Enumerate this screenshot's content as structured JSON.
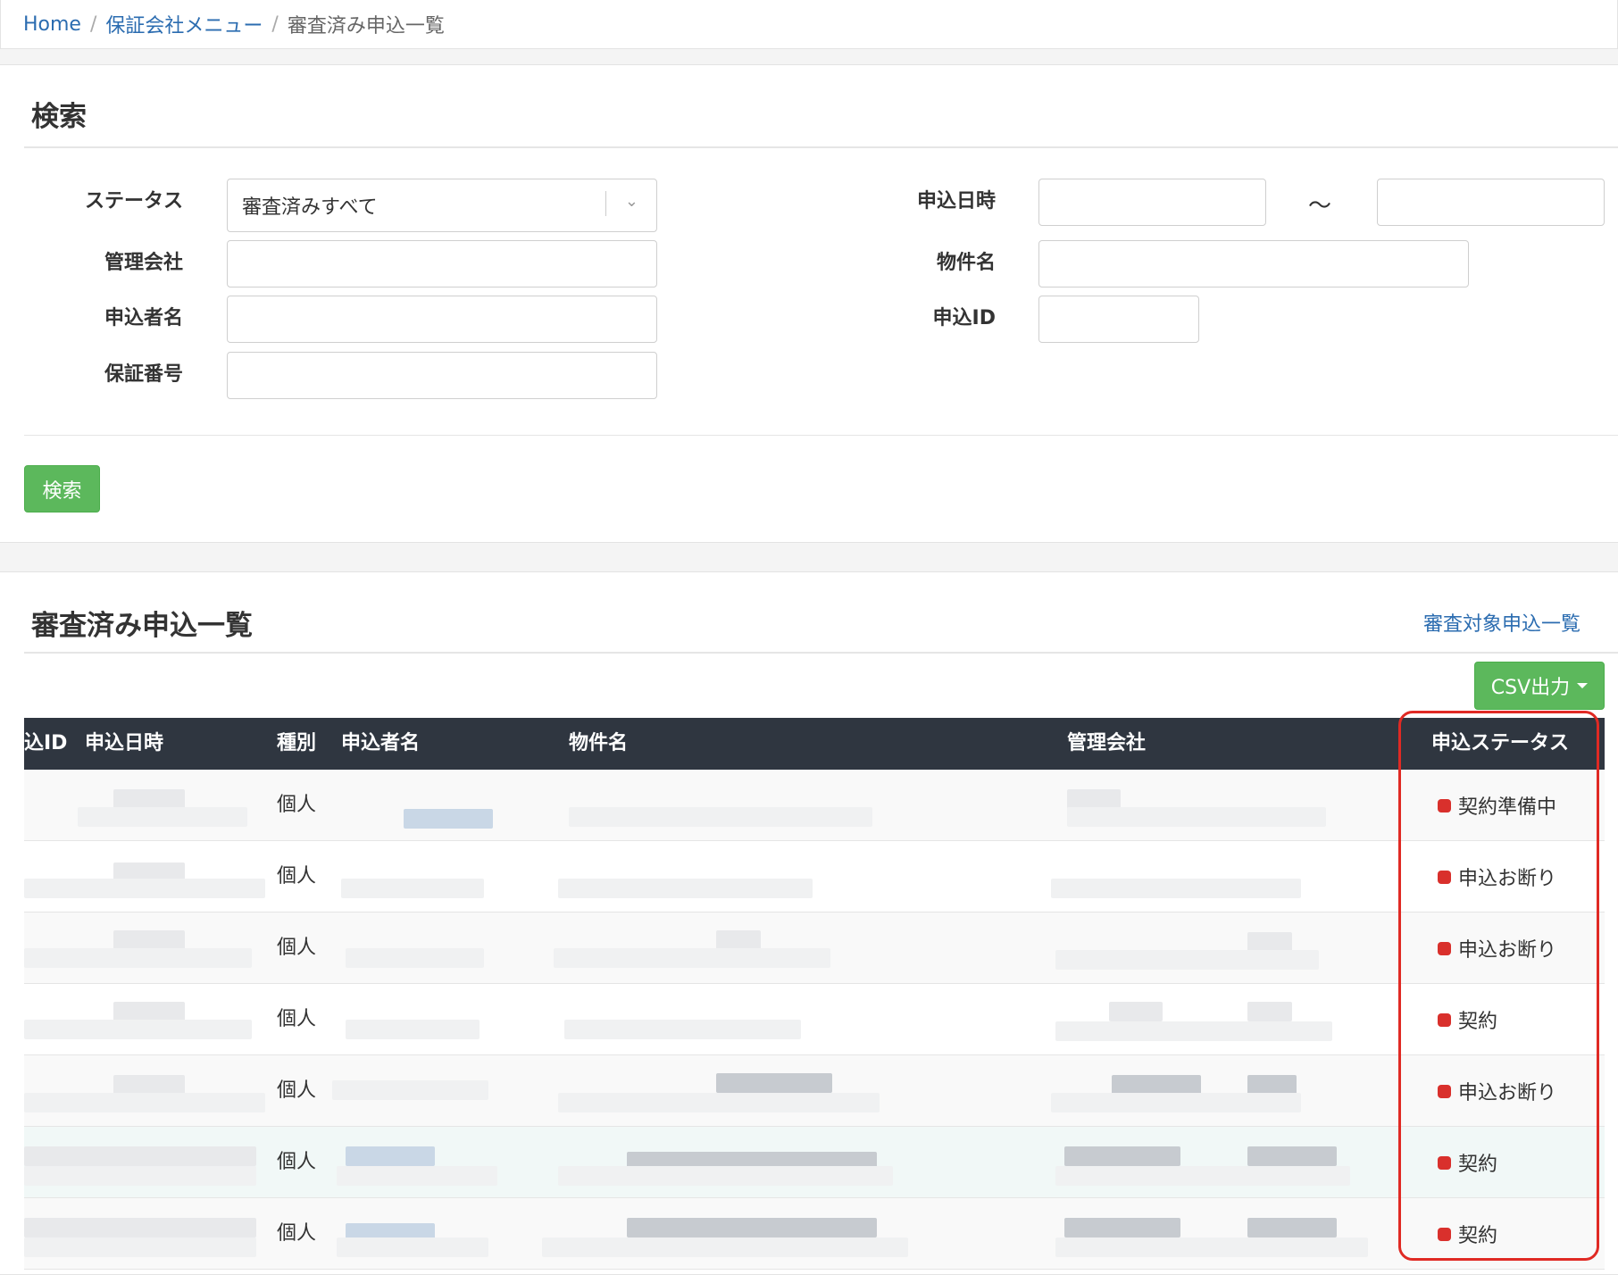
{
  "breadcrumb": {
    "home": "Home",
    "menu": "保証会社メニュー",
    "current": "審査済み申込一覧",
    "separator": "/"
  },
  "search": {
    "title": "検索",
    "status_label": "ステータス",
    "status_value": "審査済みすべて",
    "company_label": "管理会社",
    "applicant_label": "申込者名",
    "guarantee_label": "保証番号",
    "date_label": "申込日時",
    "date_tilde": "〜",
    "property_label": "物件名",
    "id_label": "申込ID",
    "button": "検索"
  },
  "list": {
    "title": "審査済み申込一覧",
    "link": "審査対象申込一覧",
    "csv_button": "CSV出力",
    "columns": {
      "id": "込ID",
      "date": "申込日時",
      "type": "種別",
      "applicant": "申込者名",
      "property": "物件名",
      "company": "管理会社",
      "status": "申込ステータス"
    },
    "rows": [
      {
        "type": "個人",
        "status": "契約準備中"
      },
      {
        "type": "個人",
        "status": "申込お断り"
      },
      {
        "type": "個人",
        "status": "申込お断り"
      },
      {
        "type": "個人",
        "status": "契約"
      },
      {
        "type": "個人",
        "status": "申込お断り"
      },
      {
        "type": "個人",
        "status": "契約"
      },
      {
        "type": "個人",
        "status": "契約"
      }
    ]
  },
  "colors": {
    "accent_green": "#5cb85c",
    "link_blue": "#2b6cb0",
    "header_dark": "#2f3640",
    "status_red": "#d9302c",
    "highlight_red": "#e02a24"
  }
}
